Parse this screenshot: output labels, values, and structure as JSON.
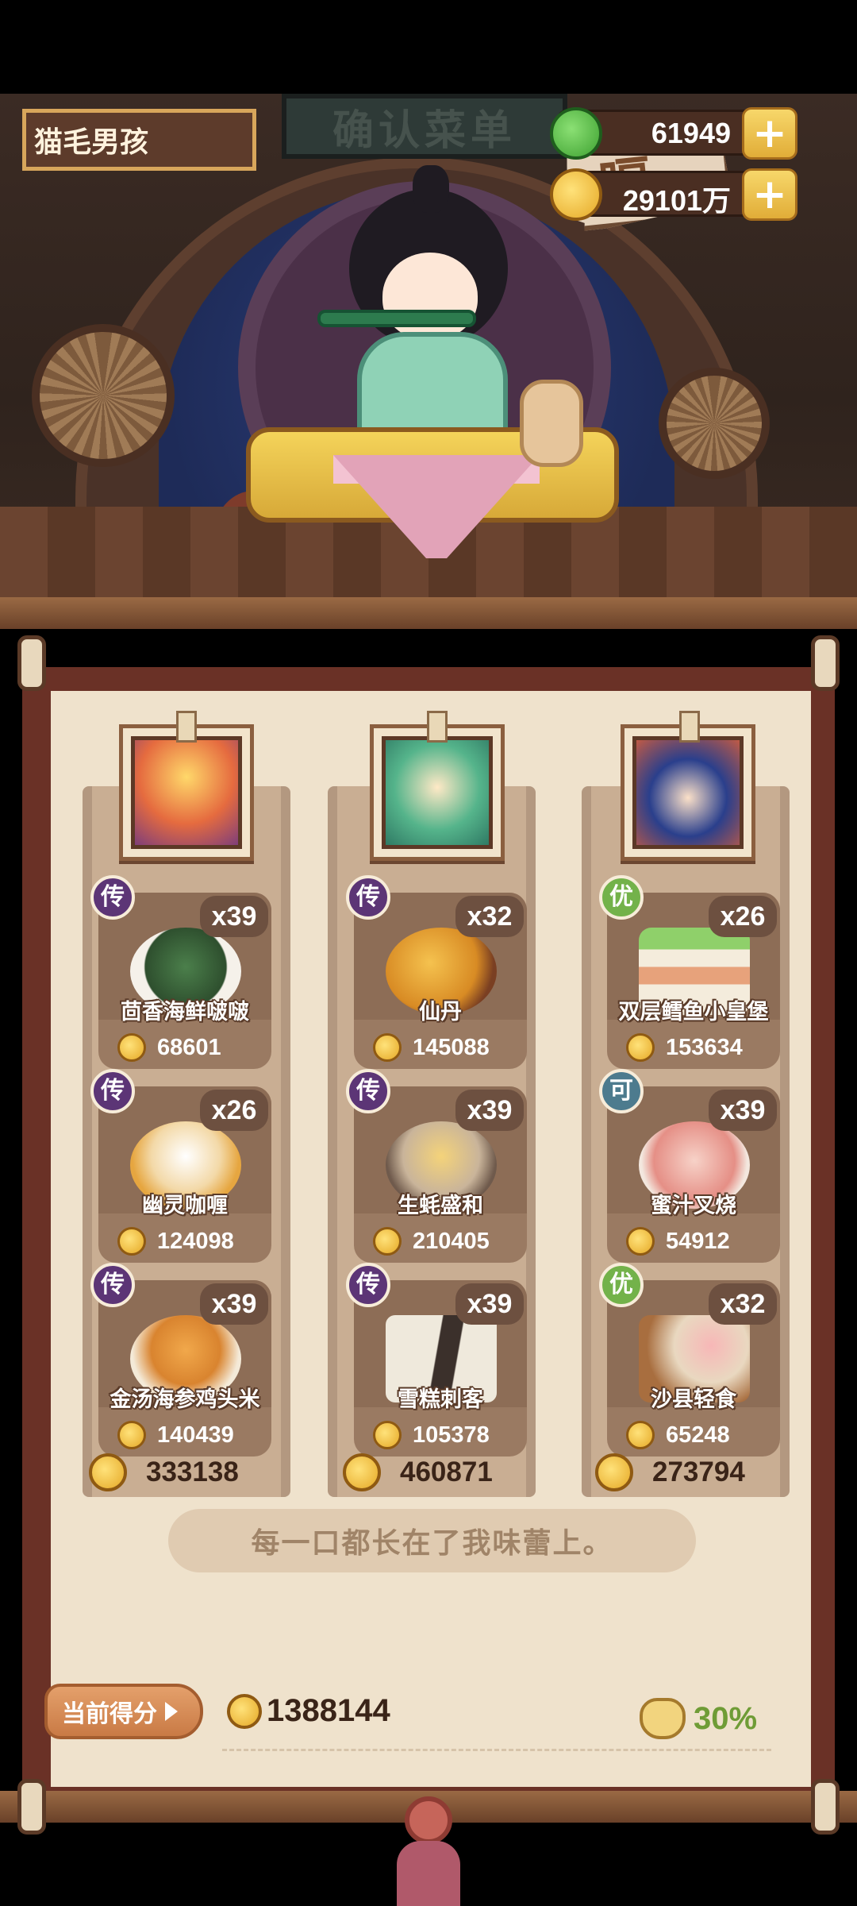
{
  "header": {
    "player_name": "猫毛男孩",
    "jade": "61949",
    "coins": "29101万",
    "sign_text": "确认菜单"
  },
  "speech": "嗝~",
  "columns": [
    {
      "dishes": [
        {
          "grade": "传",
          "count": "x39",
          "name": "茴香海鲜啵啵",
          "price": "68601"
        },
        {
          "grade": "传",
          "count": "x26",
          "name": "幽灵咖喱",
          "price": "124098"
        },
        {
          "grade": "传",
          "count": "x39",
          "name": "金汤海参鸡头米",
          "price": "140439"
        }
      ],
      "total": "333138"
    },
    {
      "dishes": [
        {
          "grade": "传",
          "count": "x32",
          "name": "仙丹",
          "price": "145088"
        },
        {
          "grade": "传",
          "count": "x39",
          "name": "生蚝盛和",
          "price": "210405"
        },
        {
          "grade": "传",
          "count": "x39",
          "name": "雪糕刺客",
          "price": "105378"
        }
      ],
      "total": "460871"
    },
    {
      "dishes": [
        {
          "grade": "优",
          "count": "x26",
          "name": "双层鳕鱼小皇堡",
          "price": "153634"
        },
        {
          "grade": "可",
          "count": "x39",
          "name": "蜜汁叉烧",
          "price": "54912"
        },
        {
          "grade": "优",
          "count": "x32",
          "name": "沙县轻食",
          "price": "65248"
        }
      ],
      "total": "273794"
    }
  ],
  "comment": "每一口都长在了我味蕾上。",
  "footer": {
    "score_button": "当前得分",
    "score": "1388144",
    "bonus": "30%"
  },
  "icons": {
    "jade": "jade-icon",
    "coin": "coin-icon",
    "plus": "plus-icon",
    "bonus": "money-bag-icon"
  },
  "colors": {
    "legend_badge": "#5c3576",
    "good_badge": "#73b24a",
    "ok_badge": "#4d7b8e",
    "bonus_text": "#6f9c36"
  }
}
